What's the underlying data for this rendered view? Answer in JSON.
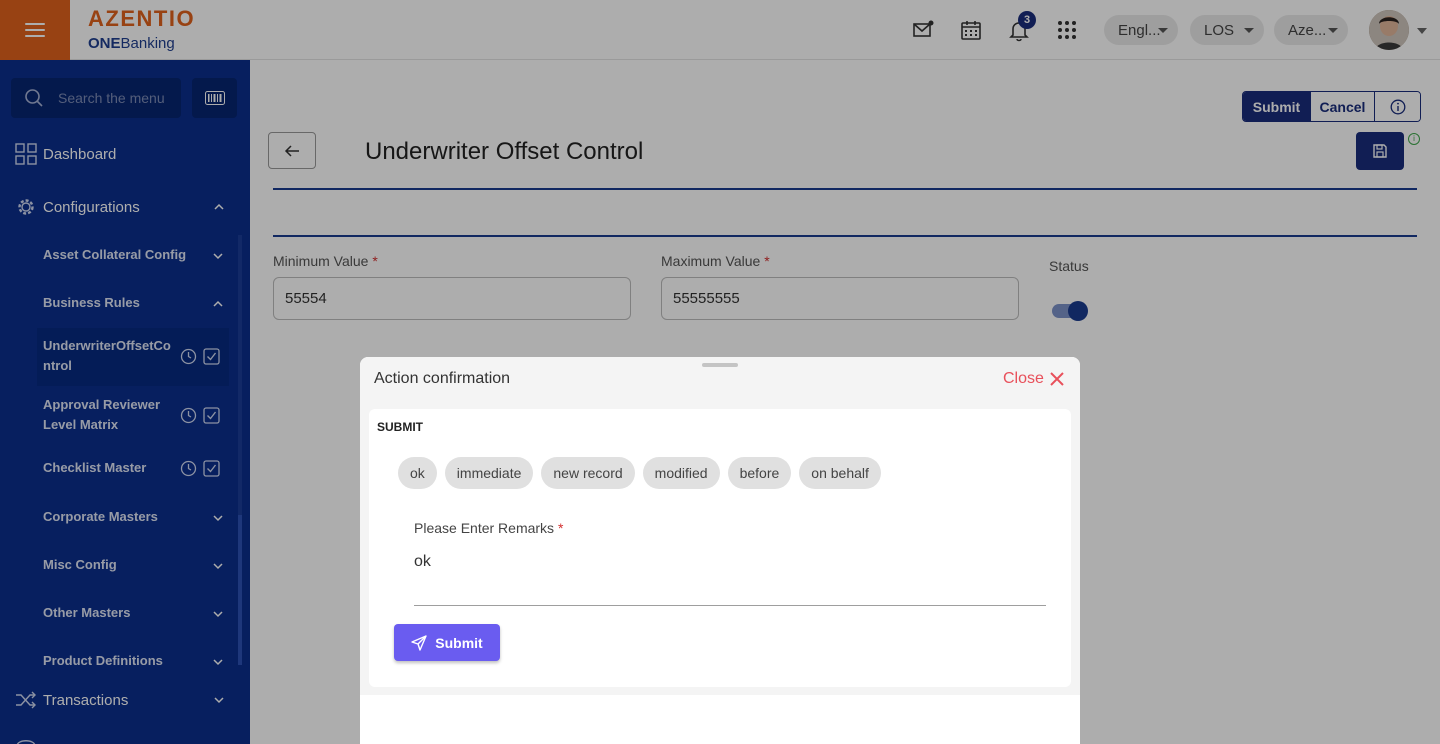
{
  "header": {
    "brand": "AZENTIO",
    "product_bold": "ONE",
    "product_rest": "Banking",
    "notification_count": "3",
    "language": "Engl...",
    "module": "LOS",
    "entity": "Aze...",
    "icons": [
      "menu-icon",
      "mail-icon",
      "calendar-icon",
      "bell-icon",
      "apps-grid-icon"
    ]
  },
  "sidebar": {
    "search_placeholder": "Search the menu",
    "dashboard": "Dashboard",
    "configurations": "Configurations",
    "items": [
      {
        "label": "Asset Collateral Config"
      },
      {
        "label": "Business Rules"
      },
      {
        "label_line1": "UnderwriterOffsetCo",
        "label_line2": "ntrol"
      },
      {
        "label_line1": "Approval Reviewer",
        "label_line2": "Level Matrix"
      },
      {
        "label": "Checklist Master"
      },
      {
        "label": "Corporate Masters"
      },
      {
        "label": "Misc Config"
      },
      {
        "label": "Other Masters"
      },
      {
        "label": "Product Definitions"
      }
    ],
    "transactions": "Transactions"
  },
  "toolbar": {
    "submit": "Submit",
    "cancel": "Cancel"
  },
  "page": {
    "title": "Underwriter Offset Control"
  },
  "form": {
    "min_label": "Minimum Value",
    "min_value": "55554",
    "max_label": "Maximum Value",
    "max_value": "55555555",
    "required_mark": "*",
    "status_label": "Status",
    "status_on": true
  },
  "dialog": {
    "title": "Action confirmation",
    "close_label": "Close",
    "section": "SUBMIT",
    "chips": [
      "ok",
      "immediate",
      "new record",
      "modified",
      "before",
      "on behalf"
    ],
    "remarks_label": "Please Enter Remarks",
    "remarks_value": "ok",
    "submit_label": "Submit"
  },
  "colors": {
    "brand_orange": "#e0621c",
    "sidebar_navy": "#0b2e8c",
    "primary": "#1a2d7c",
    "dialog_submit": "#6a5cf0",
    "close_red": "#e8505b"
  }
}
